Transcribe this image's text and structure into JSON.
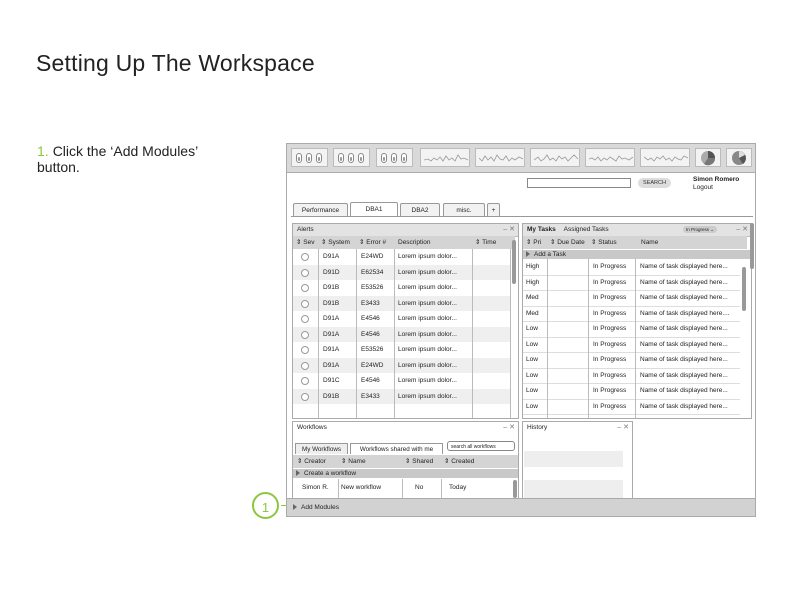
{
  "page": {
    "title": "Setting Up The Workspace",
    "step_number": "1.",
    "step_text": "Click the ‘Add Modules’ button.",
    "callout_number": "1"
  },
  "colors": {
    "accent": "#8dc63f",
    "panel_header": "#e3e3e3",
    "bottom_bar": "#d2d2d2"
  },
  "header": {
    "search_placeholder": "",
    "search_label": "SEARCH",
    "user_name": "Simon Romero",
    "logout_label": "Logout",
    "widgets": [
      "toggle-group",
      "toggle-group",
      "toggle-group",
      "sparkline",
      "sparkline",
      "sparkline",
      "sparkline",
      "sparkline",
      "pie-chart",
      "pie-chart"
    ]
  },
  "tabs": [
    {
      "label": "Performance"
    },
    {
      "label": "DBA1",
      "active": true
    },
    {
      "label": "DBA2"
    },
    {
      "label": "misc."
    },
    {
      "label": "+"
    }
  ],
  "alerts": {
    "title": "Alerts",
    "controls": "– ✕",
    "columns": [
      "⇕ Sev",
      "⇕ System",
      "⇕ Error #",
      "Description",
      "⇕ Time"
    ],
    "rows": [
      {
        "system": "D91A",
        "error": "E24WD",
        "desc": "Lorem ipsum dolor..."
      },
      {
        "system": "D91D",
        "error": "E62534",
        "desc": "Lorem ipsum dolor..."
      },
      {
        "system": "D91B",
        "error": "E53526",
        "desc": "Lorem ipsum dolor..."
      },
      {
        "system": "D91B",
        "error": "E3433",
        "desc": "Lorem ipsum dolor..."
      },
      {
        "system": "D91A",
        "error": "E4546",
        "desc": "Lorem ipsum dolor..."
      },
      {
        "system": "D91A",
        "error": "E4546",
        "desc": "Lorem ipsum dolor..."
      },
      {
        "system": "D91A",
        "error": "E53526",
        "desc": "Lorem ipsum dolor..."
      },
      {
        "system": "D91A",
        "error": "E24WD",
        "desc": "Lorem ipsum dolor..."
      },
      {
        "system": "D91C",
        "error": "E4546",
        "desc": "Lorem ipsum dolor..."
      },
      {
        "system": "D91B",
        "error": "E3433",
        "desc": "Lorem ipsum dolor..."
      }
    ]
  },
  "tasks": {
    "title": "My Tasks",
    "subtitle": "Assigned Tasks",
    "filter": "In Progress ⌄",
    "controls": "– ✕",
    "columns": [
      "⇕ Pri",
      "⇕ Due Date",
      "⇕ Status",
      "Name"
    ],
    "add_label": "Add a Task",
    "rows": [
      {
        "pri": "High",
        "status": "In Progress",
        "name": "Name of task displayed here..."
      },
      {
        "pri": "High",
        "status": "In Progress",
        "name": "Name of task displayed here..."
      },
      {
        "pri": "Med",
        "status": "In Progress",
        "name": "Name of task displayed here..."
      },
      {
        "pri": "Med",
        "status": "In Progress",
        "name": "Name of task displayed here...."
      },
      {
        "pri": "Low",
        "status": "In Progress",
        "name": "Name of task displayed here..."
      },
      {
        "pri": "Low",
        "status": "In Progress",
        "name": "Name of task displayed here..."
      },
      {
        "pri": "Low",
        "status": "In Progress",
        "name": "Name of task displayed here..."
      },
      {
        "pri": "Low",
        "status": "In Progress",
        "name": "Name of task displayed here..."
      },
      {
        "pri": "Low",
        "status": "In Progress",
        "name": "Name of task displayed here..."
      },
      {
        "pri": "Low",
        "status": "In Progress",
        "name": "Name of task displayed here..."
      }
    ]
  },
  "workflows": {
    "title": "Workflows",
    "controls": "– ✕",
    "tab_mine": "My Workflows",
    "tab_shared": "Workflows shared with me",
    "search_placeholder": "search all workflows",
    "columns": [
      "⇕ Creator",
      "⇕ Name",
      "⇕ Shared",
      "⇕ Created"
    ],
    "create_label": "Create a workflow",
    "rows": [
      {
        "creator": "Simon R.",
        "name": "New workflow",
        "shared": "No",
        "created": "Today"
      }
    ]
  },
  "history": {
    "title": "History",
    "controls": "– ✕"
  },
  "bottom": {
    "add_modules_label": "Add Modules"
  }
}
